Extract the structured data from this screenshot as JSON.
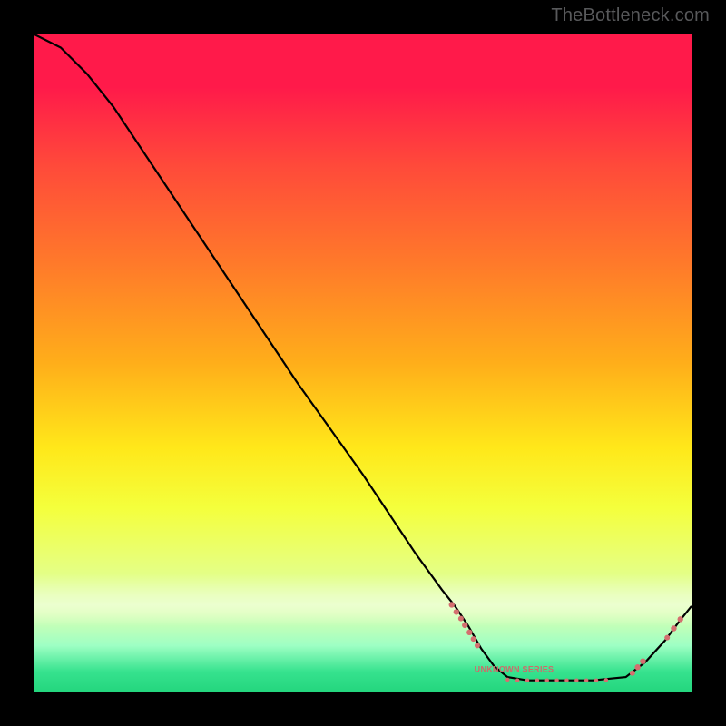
{
  "watermark": "TheBottleneck.com",
  "colors": {
    "curve": "#000000",
    "points": "#d46f6f",
    "annotation": "#cf6a6a"
  },
  "chart_data": {
    "type": "line",
    "title": "",
    "xlabel": "",
    "ylabel": "",
    "xlim": [
      0,
      100
    ],
    "ylim": [
      0,
      100
    ],
    "grid": false,
    "legend": false,
    "background": "vertical gradient red→orange→yellow→green (top→bottom)",
    "annotation": {
      "text": "UNKNOWN SERIES",
      "x": 73,
      "y": 3
    },
    "curve": [
      {
        "x": 0,
        "y": 100
      },
      {
        "x": 4,
        "y": 98
      },
      {
        "x": 8,
        "y": 94
      },
      {
        "x": 12,
        "y": 89
      },
      {
        "x": 20,
        "y": 77
      },
      {
        "x": 30,
        "y": 62
      },
      {
        "x": 40,
        "y": 47
      },
      {
        "x": 50,
        "y": 33
      },
      {
        "x": 58,
        "y": 21
      },
      {
        "x": 62,
        "y": 15.5
      },
      {
        "x": 64,
        "y": 13
      },
      {
        "x": 66,
        "y": 10
      },
      {
        "x": 68,
        "y": 6.5
      },
      {
        "x": 70,
        "y": 3.8
      },
      {
        "x": 72,
        "y": 2.2
      },
      {
        "x": 75,
        "y": 1.7
      },
      {
        "x": 80,
        "y": 1.7
      },
      {
        "x": 85,
        "y": 1.7
      },
      {
        "x": 90,
        "y": 2.2
      },
      {
        "x": 93,
        "y": 4.5
      },
      {
        "x": 96,
        "y": 7.8
      },
      {
        "x": 98,
        "y": 10.5
      },
      {
        "x": 100,
        "y": 13
      }
    ],
    "series": [
      {
        "name": "points-cluster-left",
        "type": "scatter",
        "points": [
          {
            "x": 63.5,
            "y": 13.2,
            "r": 3.2
          },
          {
            "x": 64.2,
            "y": 12.1,
            "r": 3.2
          },
          {
            "x": 64.9,
            "y": 11.1,
            "r": 3.0
          },
          {
            "x": 65.5,
            "y": 10.1,
            "r": 3.2
          },
          {
            "x": 66.2,
            "y": 9.0,
            "r": 3.2
          },
          {
            "x": 66.8,
            "y": 8.0,
            "r": 3.0
          },
          {
            "x": 67.4,
            "y": 7.0,
            "r": 3.0
          }
        ]
      },
      {
        "name": "points-bottom-run",
        "type": "scatter",
        "points": [
          {
            "x": 72,
            "y": 1.8,
            "r": 2.2
          },
          {
            "x": 73.5,
            "y": 1.7,
            "r": 2.2
          },
          {
            "x": 75,
            "y": 1.7,
            "r": 2.2
          },
          {
            "x": 76.5,
            "y": 1.7,
            "r": 2.2
          },
          {
            "x": 78,
            "y": 1.7,
            "r": 2.2
          },
          {
            "x": 79.5,
            "y": 1.7,
            "r": 2.2
          },
          {
            "x": 81,
            "y": 1.7,
            "r": 2.2
          },
          {
            "x": 82.5,
            "y": 1.7,
            "r": 2.2
          },
          {
            "x": 84,
            "y": 1.7,
            "r": 2.2
          },
          {
            "x": 85.5,
            "y": 1.7,
            "r": 2.2
          },
          {
            "x": 87,
            "y": 1.75,
            "r": 2.2
          }
        ]
      },
      {
        "name": "points-cluster-right",
        "type": "scatter",
        "points": [
          {
            "x": 91.0,
            "y": 2.8,
            "r": 3.0
          },
          {
            "x": 91.8,
            "y": 3.7,
            "r": 3.2
          },
          {
            "x": 92.6,
            "y": 4.6,
            "r": 3.2
          },
          {
            "x": 96.3,
            "y": 8.2,
            "r": 3.0
          },
          {
            "x": 97.3,
            "y": 9.6,
            "r": 3.2
          },
          {
            "x": 98.3,
            "y": 11.0,
            "r": 3.2
          }
        ]
      }
    ]
  }
}
